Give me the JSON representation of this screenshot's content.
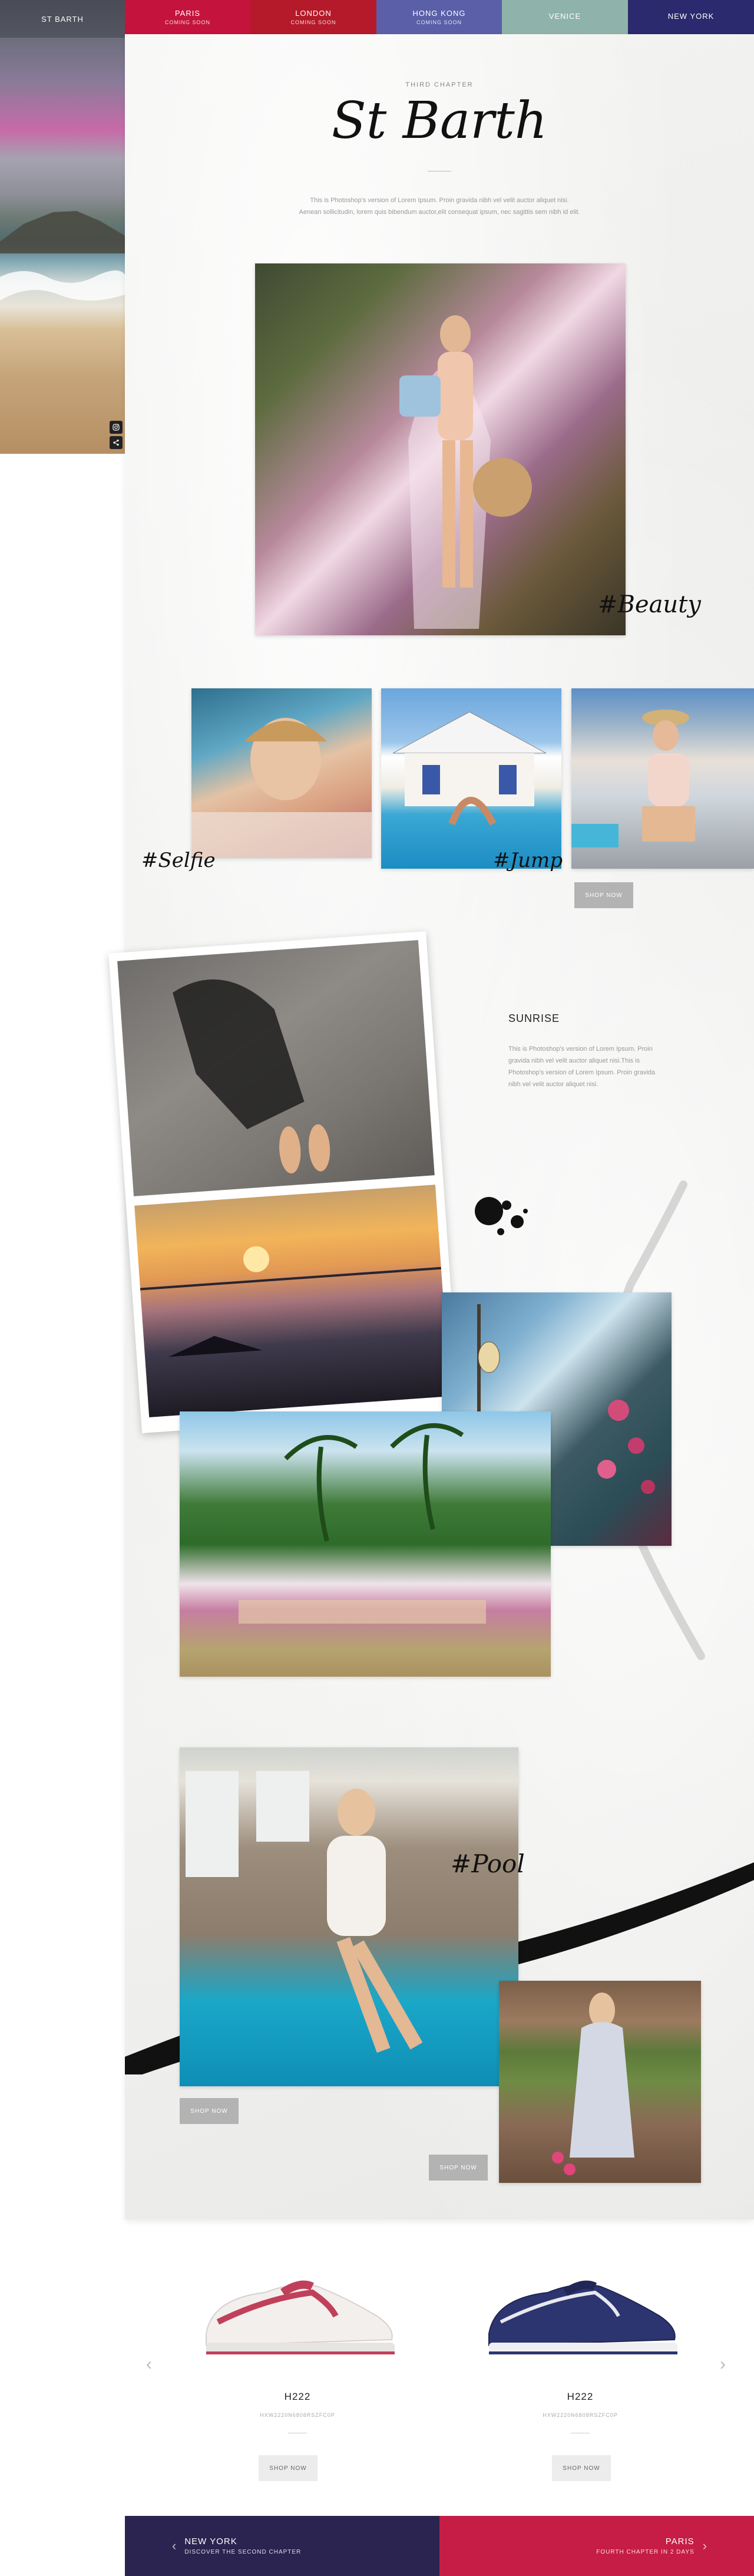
{
  "sidebar": {
    "brand": "ST BARTH"
  },
  "nav": [
    {
      "name": "PARIS",
      "sub": "COMING SOON",
      "color": "#c4143d"
    },
    {
      "name": "LONDON",
      "sub": "COMING SOON",
      "color": "#b51a2a"
    },
    {
      "name": "HONG KONG",
      "sub": "COMING SOON",
      "color": "#5a5fa8"
    },
    {
      "name": "VENICE",
      "sub": "",
      "color": "#8fb3aa"
    },
    {
      "name": "NEW YORK",
      "sub": "",
      "color": "#2c2a6e"
    }
  ],
  "chapter": {
    "label": "THIRD CHAPTER",
    "title": "St Barth",
    "intro": [
      "This is Photoshop's version  of Lorem Ipsum. Proin gravida nibh vel velit auctor aliquet nisi.",
      "Aenean sollicitudin, lorem quis bibendum auctor,elit consequat ipsum, nec sagittis sem nibh id elit."
    ]
  },
  "hashtags": {
    "beauty": "#Beauty",
    "selfie": "#Selfie",
    "jump": "#Jump",
    "pool": "#Pool"
  },
  "sunrise": {
    "title": "SUNRISE",
    "text": [
      "This is Photoshop's version  of Lorem Ipsum. Proin",
      "gravida nibh vel velit auctor aliquet nisi.This is",
      "Photoshop's version  of  Lorem Ipsum. Proin gravida",
      "nibh vel velit auctor aliquet nisi."
    ]
  },
  "buttons": {
    "shop_now": "SHOP NOW"
  },
  "products": [
    {
      "name": "H222",
      "code": "HXW2220N6808RSZFC0P"
    },
    {
      "name": "H222",
      "code": "HXW2220N6808RSZFC0P"
    }
  ],
  "footer_nav": {
    "prev": {
      "name": "NEW YORK",
      "sub": "DISCOVER THE SECOND CHAPTER",
      "color": "#2b2450"
    },
    "next": {
      "name": "PARIS",
      "sub": "FOURTH CHAPTER IN 2 DAYS",
      "color": "#c51d45"
    }
  },
  "icons": {
    "instagram": "instagram-icon",
    "share": "share-icon",
    "prev": "chevron-left-icon",
    "next": "chevron-right-icon"
  }
}
